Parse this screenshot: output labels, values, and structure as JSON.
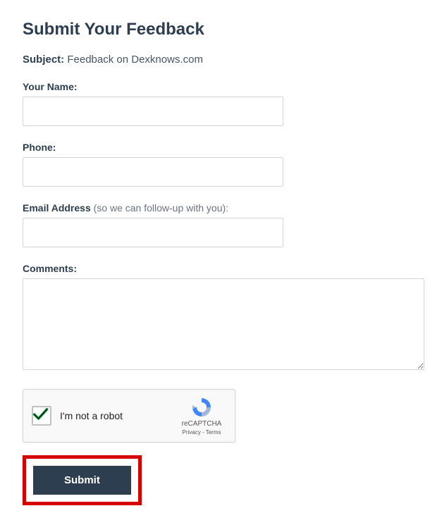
{
  "title": "Submit Your Feedback",
  "subject": {
    "label": "Subject:",
    "value": "Feedback on Dexknows.com"
  },
  "fields": {
    "name": {
      "label": "Your Name:",
      "value": ""
    },
    "phone": {
      "label": "Phone:",
      "value": ""
    },
    "email": {
      "label": "Email Address",
      "hint": " (so we can follow-up with you):",
      "value": ""
    },
    "comments": {
      "label": "Comments:",
      "value": ""
    }
  },
  "recaptcha": {
    "label": "I'm not a robot",
    "brand": "reCAPTCHA",
    "privacy": "Privacy",
    "terms": "Terms",
    "separator": " - "
  },
  "submit": {
    "label": "Submit"
  }
}
